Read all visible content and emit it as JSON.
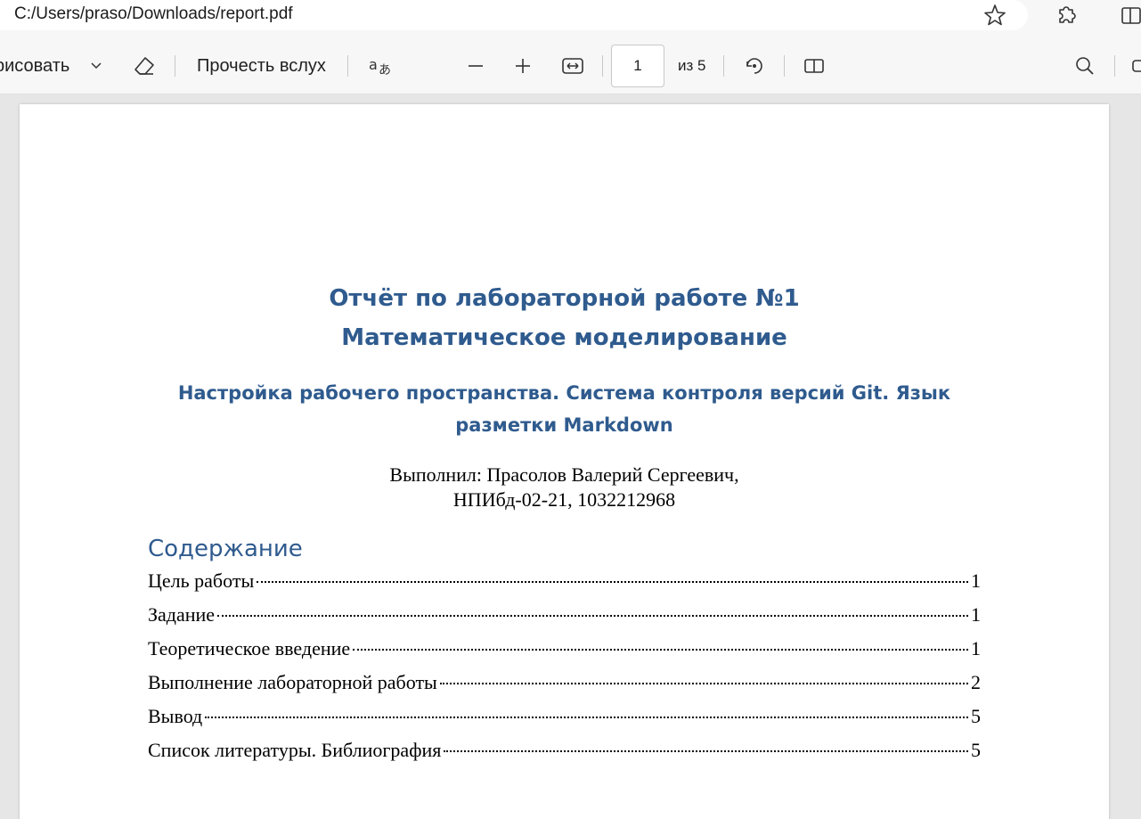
{
  "browser": {
    "url": "C:/Users/praso/Downloads/report.pdf"
  },
  "toolbar": {
    "draw_label": "рисовать",
    "read_aloud_label": "Прочесть вслух",
    "page_number": "1",
    "page_total": "из 5"
  },
  "document": {
    "title_line1": "Отчёт по лабораторной работе №1",
    "title_line2": "Математическое моделирование",
    "subtitle_line1": "Настройка рабочего пространства. Система контроля версий Git. Язык",
    "subtitle_line2": "разметки Markdown",
    "author_line1": "Выполнил: Прасолов Валерий Сергеевич,",
    "author_line2": "НПИбд-02-21, 1032212968",
    "toc_heading": "Содержание",
    "toc": [
      {
        "label": "Цель работы",
        "page": "1"
      },
      {
        "label": "Задание",
        "page": "1"
      },
      {
        "label": "Теоретическое введение",
        "page": "1"
      },
      {
        "label": "Выполнение лабораторной работы",
        "page": "2"
      },
      {
        "label": "Вывод",
        "page": "5"
      },
      {
        "label": "Список литературы. Библиография",
        "page": "5"
      }
    ]
  },
  "colors": {
    "heading_blue": "#2f5b8e"
  },
  "icons": [
    "star-icon",
    "extensions-icon",
    "split-screen-icon",
    "chevron-down-icon",
    "eraser-icon",
    "translate-icon",
    "zoom-out-icon",
    "zoom-in-icon",
    "fit-width-icon",
    "rotate-icon",
    "page-view-icon",
    "search-icon"
  ]
}
